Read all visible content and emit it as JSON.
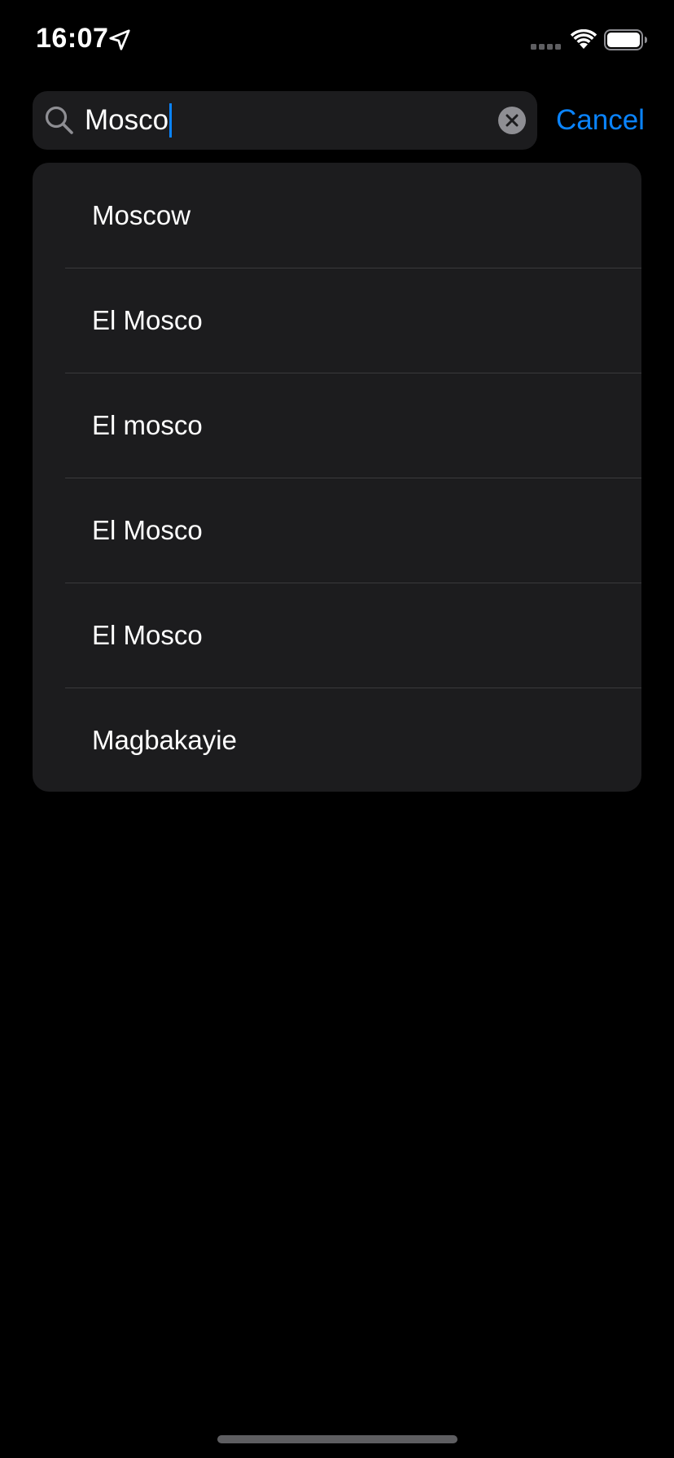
{
  "status_bar": {
    "time": "16:07",
    "location_icon": "location-arrow-icon",
    "signal_icon": "cellular-signal-icon",
    "wifi_icon": "wifi-icon",
    "battery_icon": "battery-icon"
  },
  "search": {
    "value": "Mosco",
    "icon": "search-icon",
    "clear_icon": "clear-icon",
    "cancel_label": "Cancel"
  },
  "results": [
    {
      "label": "Moscow"
    },
    {
      "label": "El Mosco"
    },
    {
      "label": "El mosco"
    },
    {
      "label": "El Mosco"
    },
    {
      "label": "El Mosco"
    },
    {
      "label": "Magbakayie"
    }
  ],
  "colors": {
    "background": "#000000",
    "surface": "#1c1c1e",
    "accent": "#0a84ff",
    "separator": "#3a3a3c",
    "text": "#ffffff"
  }
}
